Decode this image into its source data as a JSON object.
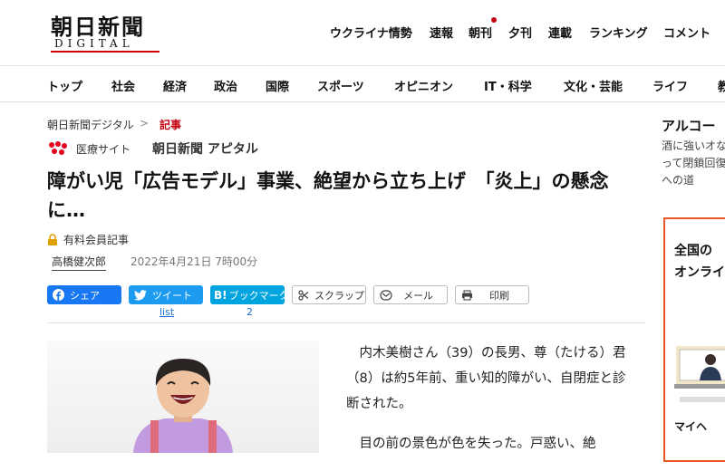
{
  "header": {
    "logo_main": "朝日新聞",
    "logo_sub": "DIGITAL",
    "nav": [
      "ウクライナ情勢",
      "速報",
      "朝刊",
      "夕刊",
      "連載",
      "ランキング",
      "コメント"
    ]
  },
  "main_nav": [
    "トップ",
    "社会",
    "経済",
    "政治",
    "国際",
    "スポーツ",
    "オピニオン",
    "IT・科学",
    "文化・芸能",
    "ライフ",
    "教"
  ],
  "breadcrumb": {
    "home": "朝日新聞デジタル",
    "separator": ">",
    "current": "記事"
  },
  "apital": {
    "label": "医療サイト",
    "brand": "朝日新聞 アピタル"
  },
  "article": {
    "headline": "障がい児「広告モデル」事業、絶望から立ち上げ　「炎上」の懸念に…",
    "paid_label": "有料会員記事",
    "author": "高橋健次郎",
    "date": "2022年4月21日 7時00分",
    "paragraphs": [
      "内木美樹さん（39）の長男、尊（たける）君（8）は約5年前、重い知的障がい、自閉症と診断された。",
      "目の前の景色が色を失った。戸惑い、絶"
    ]
  },
  "share": {
    "facebook": "シェア",
    "twitter": "ツイート",
    "twitter_count": "list",
    "hatena": "ブックマーク",
    "hatena_count": "2",
    "scrap": "スクラップ",
    "mail": "メール",
    "print": "印刷"
  },
  "sidebar": {
    "title": "アルコー",
    "text": "酒に強いオなって閉鎖回復への道",
    "ad_line1": "全国の",
    "ad_line2": "オンライ",
    "ad_line3": "マイヘ"
  },
  "colors": {
    "accent_red": "#c4000f",
    "facebook": "#1877f2",
    "twitter": "#1d9bf0",
    "hatena": "#00a4de",
    "ad_border": "#e8562a"
  },
  "icons": [
    "lock-icon",
    "apital-dots-icon",
    "facebook-icon",
    "twitter-icon",
    "hatena-icon",
    "scissors-icon",
    "mail-icon",
    "printer-icon"
  ]
}
